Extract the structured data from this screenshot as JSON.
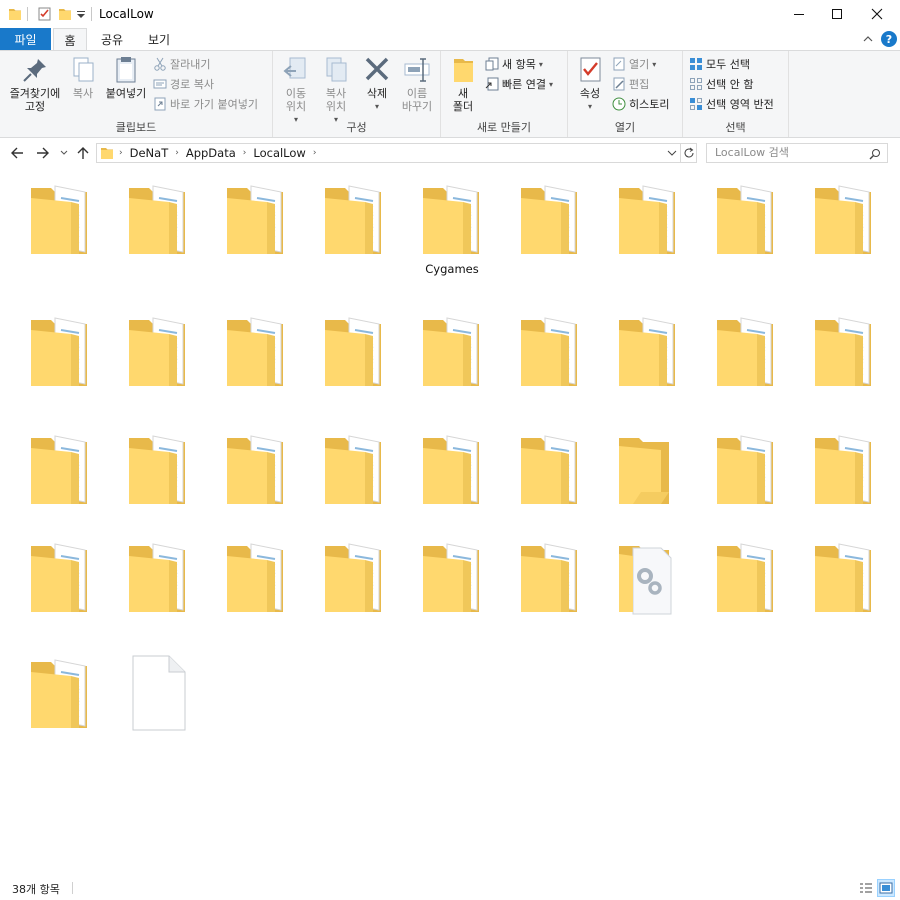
{
  "window": {
    "title": "LocalLow",
    "minimize_glyph": "—",
    "maximize_glyph": "☐",
    "close_glyph": "✕"
  },
  "ribbon_tabs": [
    {
      "label": "파일"
    },
    {
      "label": "홈"
    },
    {
      "label": "공유"
    },
    {
      "label": "보기"
    }
  ],
  "ribbon": {
    "clipboard": {
      "group_label": "클립보드",
      "pin_label": "즐겨찾기에\n고정",
      "copy_label": "복사",
      "paste_label": "붙여넣기",
      "cut_label": "잘라내기",
      "copy_path_label": "경로 복사",
      "paste_shortcut_label": "바로 가기 붙여넣기"
    },
    "organize": {
      "group_label": "구성",
      "move_label": "이동\n위치",
      "copyto_label": "복사\n위치",
      "delete_label": "삭제",
      "rename_label": "이름\n바꾸기"
    },
    "new": {
      "group_label": "새로 만들기",
      "new_folder_label": "새\n폴더",
      "new_item_label": "새 항목",
      "easy_access_label": "빠른 연결"
    },
    "open": {
      "group_label": "열기",
      "properties_label": "속성",
      "open_label": "열기",
      "edit_label": "편집",
      "history_label": "히스토리"
    },
    "select": {
      "group_label": "선택",
      "select_all_label": "모두 선택",
      "select_none_label": "선택 안 함",
      "invert_label": "선택 영역 반전"
    }
  },
  "address": {
    "breadcrumb": [
      "DeNaT",
      "AppData",
      "LocalLow"
    ],
    "separator": "›"
  },
  "search": {
    "placeholder": "LocalLow 검색"
  },
  "items": [
    {
      "type": "folder-docs",
      "name": ""
    },
    {
      "type": "folder-docs",
      "name": ""
    },
    {
      "type": "folder-docs",
      "name": ""
    },
    {
      "type": "folder-docs",
      "name": ""
    },
    {
      "type": "folder-docs",
      "name": "Cygames"
    },
    {
      "type": "folder-docs",
      "name": ""
    },
    {
      "type": "folder-docs",
      "name": ""
    },
    {
      "type": "folder-docs",
      "name": ""
    },
    {
      "type": "folder-docs",
      "name": ""
    },
    {
      "type": "folder-docs",
      "name": ""
    },
    {
      "type": "folder-docs",
      "name": ""
    },
    {
      "type": "folder-docs",
      "name": ""
    },
    {
      "type": "folder-docs",
      "name": ""
    },
    {
      "type": "folder-docs",
      "name": ""
    },
    {
      "type": "folder-docs",
      "name": ""
    },
    {
      "type": "folder-docs",
      "name": ""
    },
    {
      "type": "folder-docs",
      "name": ""
    },
    {
      "type": "folder-docs",
      "name": ""
    },
    {
      "type": "folder-docs",
      "name": ""
    },
    {
      "type": "folder-docs",
      "name": ""
    },
    {
      "type": "folder-docs",
      "name": ""
    },
    {
      "type": "folder-docs",
      "name": ""
    },
    {
      "type": "folder-docs",
      "name": ""
    },
    {
      "type": "folder-docs",
      "name": ""
    },
    {
      "type": "folder-empty",
      "name": ""
    },
    {
      "type": "folder-docs",
      "name": ""
    },
    {
      "type": "folder-docs",
      "name": ""
    },
    {
      "type": "folder-docs",
      "name": ""
    },
    {
      "type": "folder-docs",
      "name": ""
    },
    {
      "type": "folder-docs",
      "name": ""
    },
    {
      "type": "folder-docs",
      "name": ""
    },
    {
      "type": "folder-docs",
      "name": ""
    },
    {
      "type": "folder-docs",
      "name": ""
    },
    {
      "type": "folder-settings",
      "name": ""
    },
    {
      "type": "folder-docs",
      "name": ""
    },
    {
      "type": "folder-docs",
      "name": ""
    },
    {
      "type": "folder-docs",
      "name": ""
    },
    {
      "type": "blank-file",
      "name": ""
    }
  ],
  "status": {
    "item_count": "38개 항목"
  },
  "colors": {
    "file_tab": "#1979ca",
    "folder_back": "#e8b94a",
    "folder_front": "#ffd86e",
    "help": "#1979ca"
  }
}
